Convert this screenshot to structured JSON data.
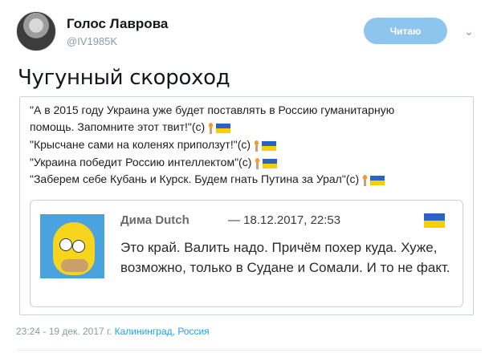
{
  "author": {
    "name": "Голос Лаврова",
    "handle": "@IV1985K"
  },
  "follow_label": "Читаю",
  "tweet_text": "Чугунный скороход",
  "quote_lines": [
    "\"А в 2015 году Украина уже будет поставлять в Россию гуманитарную",
    "помощь. Запомните этот твит!\"(с)",
    "\"Крысчане сами на коленях приползут!\"(с)",
    "\"Украина победит Россию интеллектом\"(с)",
    "\"Заберем себе Кубань и Курск. Будем гнать Путина за Урал\"(с)"
  ],
  "fb_post": {
    "name": "Дима Dutch",
    "date": "— 18.12.2017, 22:53",
    "body": "Это край. Валить надо. Причём похер куда. Хуже, возможно, только в Судане и Сомали. И то не факт."
  },
  "meta": {
    "time": "23:24 - 19 дек. 2017 г.",
    "location": "Калининград, Россия"
  },
  "colors": {
    "follow_button": "#8ec5ee",
    "link": "#1da1f2",
    "flag_blue": "#2a62c5",
    "flag_yellow": "#f5d000"
  }
}
